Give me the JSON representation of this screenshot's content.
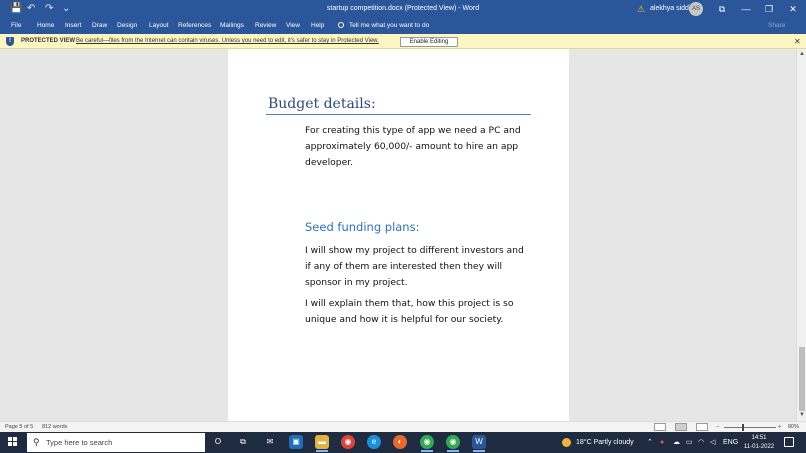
{
  "window": {
    "title": "startup competition.docx (Protected View)  -  Word",
    "user_name": "alekhya siddi",
    "user_initials": "AS",
    "buttons": {
      "ribbon_display": "⧉",
      "minimize": "—",
      "restore": "❐",
      "close": "✕"
    }
  },
  "quick_access": {
    "save": "💾",
    "undo": "↶",
    "redo": "↷",
    "customize": "⌄"
  },
  "ribbon": {
    "tabs": [
      "File",
      "Home",
      "Insert",
      "Draw",
      "Design",
      "Layout",
      "References",
      "Mailings",
      "Review",
      "View",
      "Help"
    ],
    "tell_me": "Tell me what you want to do",
    "share": "Share"
  },
  "protected_view": {
    "label": "PROTECTED VIEW",
    "message": "Be careful—files from the Internet can contain viruses. Unless you need to edit, it's safer to stay in Protected View.",
    "enable_button": "Enable Editing",
    "close": "✕"
  },
  "document": {
    "heading_budget": "Budget details:",
    "budget_lines": [
      "For creating this type of app we need a PC and",
      "approximately 60,000/- amount to hire an app",
      "developer."
    ],
    "heading_seed": "Seed funding plans:",
    "seed_para1_lines": [
      "I will show my project to different investors and",
      "if any of them are interested then they will",
      "sponsor in my project."
    ],
    "seed_para2_lines": [
      "I will explain them that, how this project is so",
      "unique and how it is helpful for our society."
    ]
  },
  "status_bar": {
    "page": "Page 5 of 5",
    "words": "812 words",
    "zoom_minus": "−",
    "zoom_plus": "+",
    "zoom": "80%"
  },
  "taskbar": {
    "search_placeholder": "Type here to search",
    "weather": "18°C  Partly cloudy",
    "language": "ENG",
    "time": "14:51",
    "date": "11-01-2022",
    "apps": [
      {
        "name": "cortana",
        "glyph": "O",
        "color": "transparent"
      },
      {
        "name": "task-view",
        "glyph": "⧉",
        "color": "transparent"
      },
      {
        "name": "mail",
        "glyph": "✉",
        "color": "transparent"
      },
      {
        "name": "photos",
        "glyph": "▣",
        "color": "#1e6fb8"
      },
      {
        "name": "file-explorer",
        "glyph": "▬",
        "color": "#e3b341"
      },
      {
        "name": "chrome",
        "glyph": "◉",
        "color": "#db4437"
      },
      {
        "name": "edge",
        "glyph": "e",
        "color": "#1d8fd6"
      },
      {
        "name": "firefox",
        "glyph": "◐",
        "color": "#e8692b"
      },
      {
        "name": "chrome-profile-1",
        "glyph": "◉",
        "color": "#34a853"
      },
      {
        "name": "chrome-profile-2",
        "glyph": "◉",
        "color": "#34a853"
      },
      {
        "name": "word",
        "glyph": "W",
        "color": "#2b579a"
      }
    ]
  },
  "colors": {
    "word_blue": "#2b579a",
    "heading": "#2b4b7a",
    "heading2": "#2e74b5",
    "protected_bar": "#fdf6c3",
    "taskbar": "#1f2b40"
  }
}
